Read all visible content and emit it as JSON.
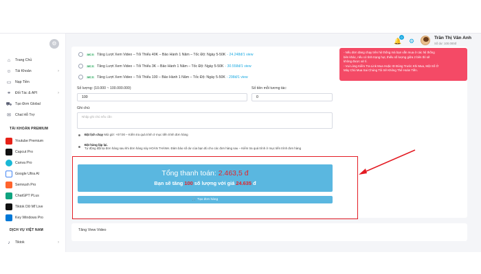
{
  "user": {
    "name": "Trần Thị Vân Anh",
    "balance": "Số dư: 100.000đ",
    "notif_count": "0"
  },
  "sidebar": {
    "items": [
      {
        "label": "Trang Chủ",
        "icon": "home-icon"
      },
      {
        "label": "Tài Khoản",
        "icon": "user-icon"
      },
      {
        "label": "Nạp Tiền",
        "icon": "wallet-icon"
      },
      {
        "label": "Đối Tác & API",
        "icon": "link-icon"
      },
      {
        "label": "Tạo Đơn Global",
        "icon": "cart-icon"
      },
      {
        "label": "Chat Hỗ Trợ",
        "icon": "chat-icon"
      }
    ],
    "section_premium": "TÀI KHOẢN PREMIUM",
    "premium": [
      {
        "label": "Youtube Premium",
        "color": "#e62117"
      },
      {
        "label": "Capcut Pro",
        "color": "#111111"
      },
      {
        "label": "Canva Pro",
        "color": "#1ab8d6"
      },
      {
        "label": "Google Ultra AI",
        "color": "#4285f4"
      },
      {
        "label": "Semrush Pro",
        "color": "#ff642d"
      },
      {
        "label": "ChatGPT PLus",
        "color": "#10a37f"
      },
      {
        "label": "Tiktok Dữ Mĩ Live",
        "color": "#111111"
      },
      {
        "label": "Key Windows Pro",
        "color": "#0078d7"
      }
    ],
    "section_vn": "DỊCH VỤ VIỆT NAM",
    "vn": [
      {
        "label": "Tiktok"
      }
    ]
  },
  "services": [
    {
      "tag": "MC 5",
      "name": "Tăng Lượt Xem Video – Tối Thiểu 40K – Bảo Hành 1 Năm – Tốc Độ: Ngày 5-50K",
      "price": "- 24.248đ/1 view"
    },
    {
      "tag": "MC 5",
      "name": "Tăng Lượt Xem Video – Tối Thiểu 3K – Bảo Hành 1 Năm – Tốc Độ: Ngày 5-50K",
      "price": "- 30.558đ/1 view"
    },
    {
      "tag": "MC 5",
      "name": "Tăng Lượt Xem Video – Tối Thiểu 100 – Bảo Hành 1 Năm – Tốc Độ: Ngày 5-50K",
      "price": "- 298đ/1 view"
    }
  ],
  "notice": [
    "- Nếu đơn đang chạy trên hệ thống mà bạn vẫn mua ở các hệ thống",
    "bên khác, nếu có tình trạng hụt, thiếu số lượng giữa 2 bên thì sẽ",
    "không được xử lí.",
    "- Vui Lòng Kiểm Tra Link Mua Hoặc ID Đúng Trước Khi Mua, Một Số Ở",
    "Mày Chủ Mua Sai Chúng Tôi Sẽ Không Thể Hoàn Tiền."
  ],
  "form": {
    "qty_label": "Số lượng: (10.000 ~ 100.000.000)",
    "qty_value": "100",
    "min_label": "Số tiền mỗi tương tác:",
    "min_value": "0",
    "note_label": "Ghi chú:",
    "note_placeholder": "Nhập ghi chú nếu cần"
  },
  "options": {
    "schedule_title": "Đặt lịch chạy",
    "schedule_text": "Mùi giờ: +07:00 – Kiểm tra quá trình ở mục tiến trình đơn hàng",
    "repeat_title": "Đặt hàng lặp lại.",
    "repeat_text": "Tự động đặt lại đơn hàng sau khi đơn hàng này HOÀN THÀNH. Đảm bảo số dư của bạn đủ cho các đơn hàng sau – Kiểm tra quá trình ở mục tiến trình đơn hàng"
  },
  "total": {
    "label": "Tổng thanh toán:",
    "amount": "2.463,5",
    "currency": "đ",
    "line_prefix": "Bạn sẽ tăng",
    "qty": "100",
    "line_mid": "số lượng với giá",
    "price": "24.635",
    "line_suffix": "đ"
  },
  "create_button": "Tạo đơn hàng",
  "next_card": "Tăng View Video",
  "colors": {
    "accent": "#5ab7e0",
    "alert": "#f44a66",
    "highlight_box": "#e31b23"
  }
}
